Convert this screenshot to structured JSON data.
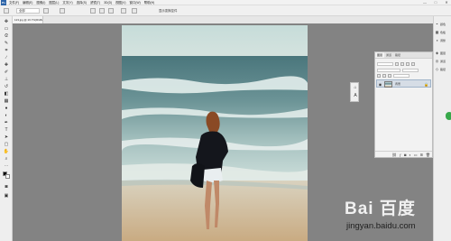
{
  "app": {
    "logo_text": "Ps"
  },
  "menu": {
    "items": [
      "文件(F)",
      "编辑(E)",
      "图像(I)",
      "图层(L)",
      "文字(Y)",
      "选择(S)",
      "滤镜(T)",
      "3D(D)",
      "视图(V)",
      "窗口(W)",
      "帮助(H)"
    ]
  },
  "window_controls": {
    "minimize": "—",
    "maximize": "□",
    "close": "✕"
  },
  "options_bar": {
    "mode_value": "全部",
    "align_label": "显示变换控件"
  },
  "document": {
    "tab_title": "123.jpg @ 16.7%(RGB/8)"
  },
  "layers_panel": {
    "tabs": [
      "图层",
      "通道",
      "路径"
    ],
    "layer_name": "背景",
    "lock_icon": "🔒"
  },
  "right_dock": {
    "items": [
      {
        "icon": "color-icon",
        "label": "颜色"
      },
      {
        "icon": "swatches-icon",
        "label": "色板"
      },
      {
        "icon": "adjust-icon",
        "label": "调整"
      },
      {
        "icon": "layers-icon",
        "label": "图层"
      },
      {
        "icon": "channels-icon",
        "label": "通道"
      },
      {
        "icon": "paths-icon",
        "label": "路径"
      }
    ]
  },
  "watermark": {
    "logo_text": "Bai 百度",
    "url": "jingyan.baidu.com"
  }
}
